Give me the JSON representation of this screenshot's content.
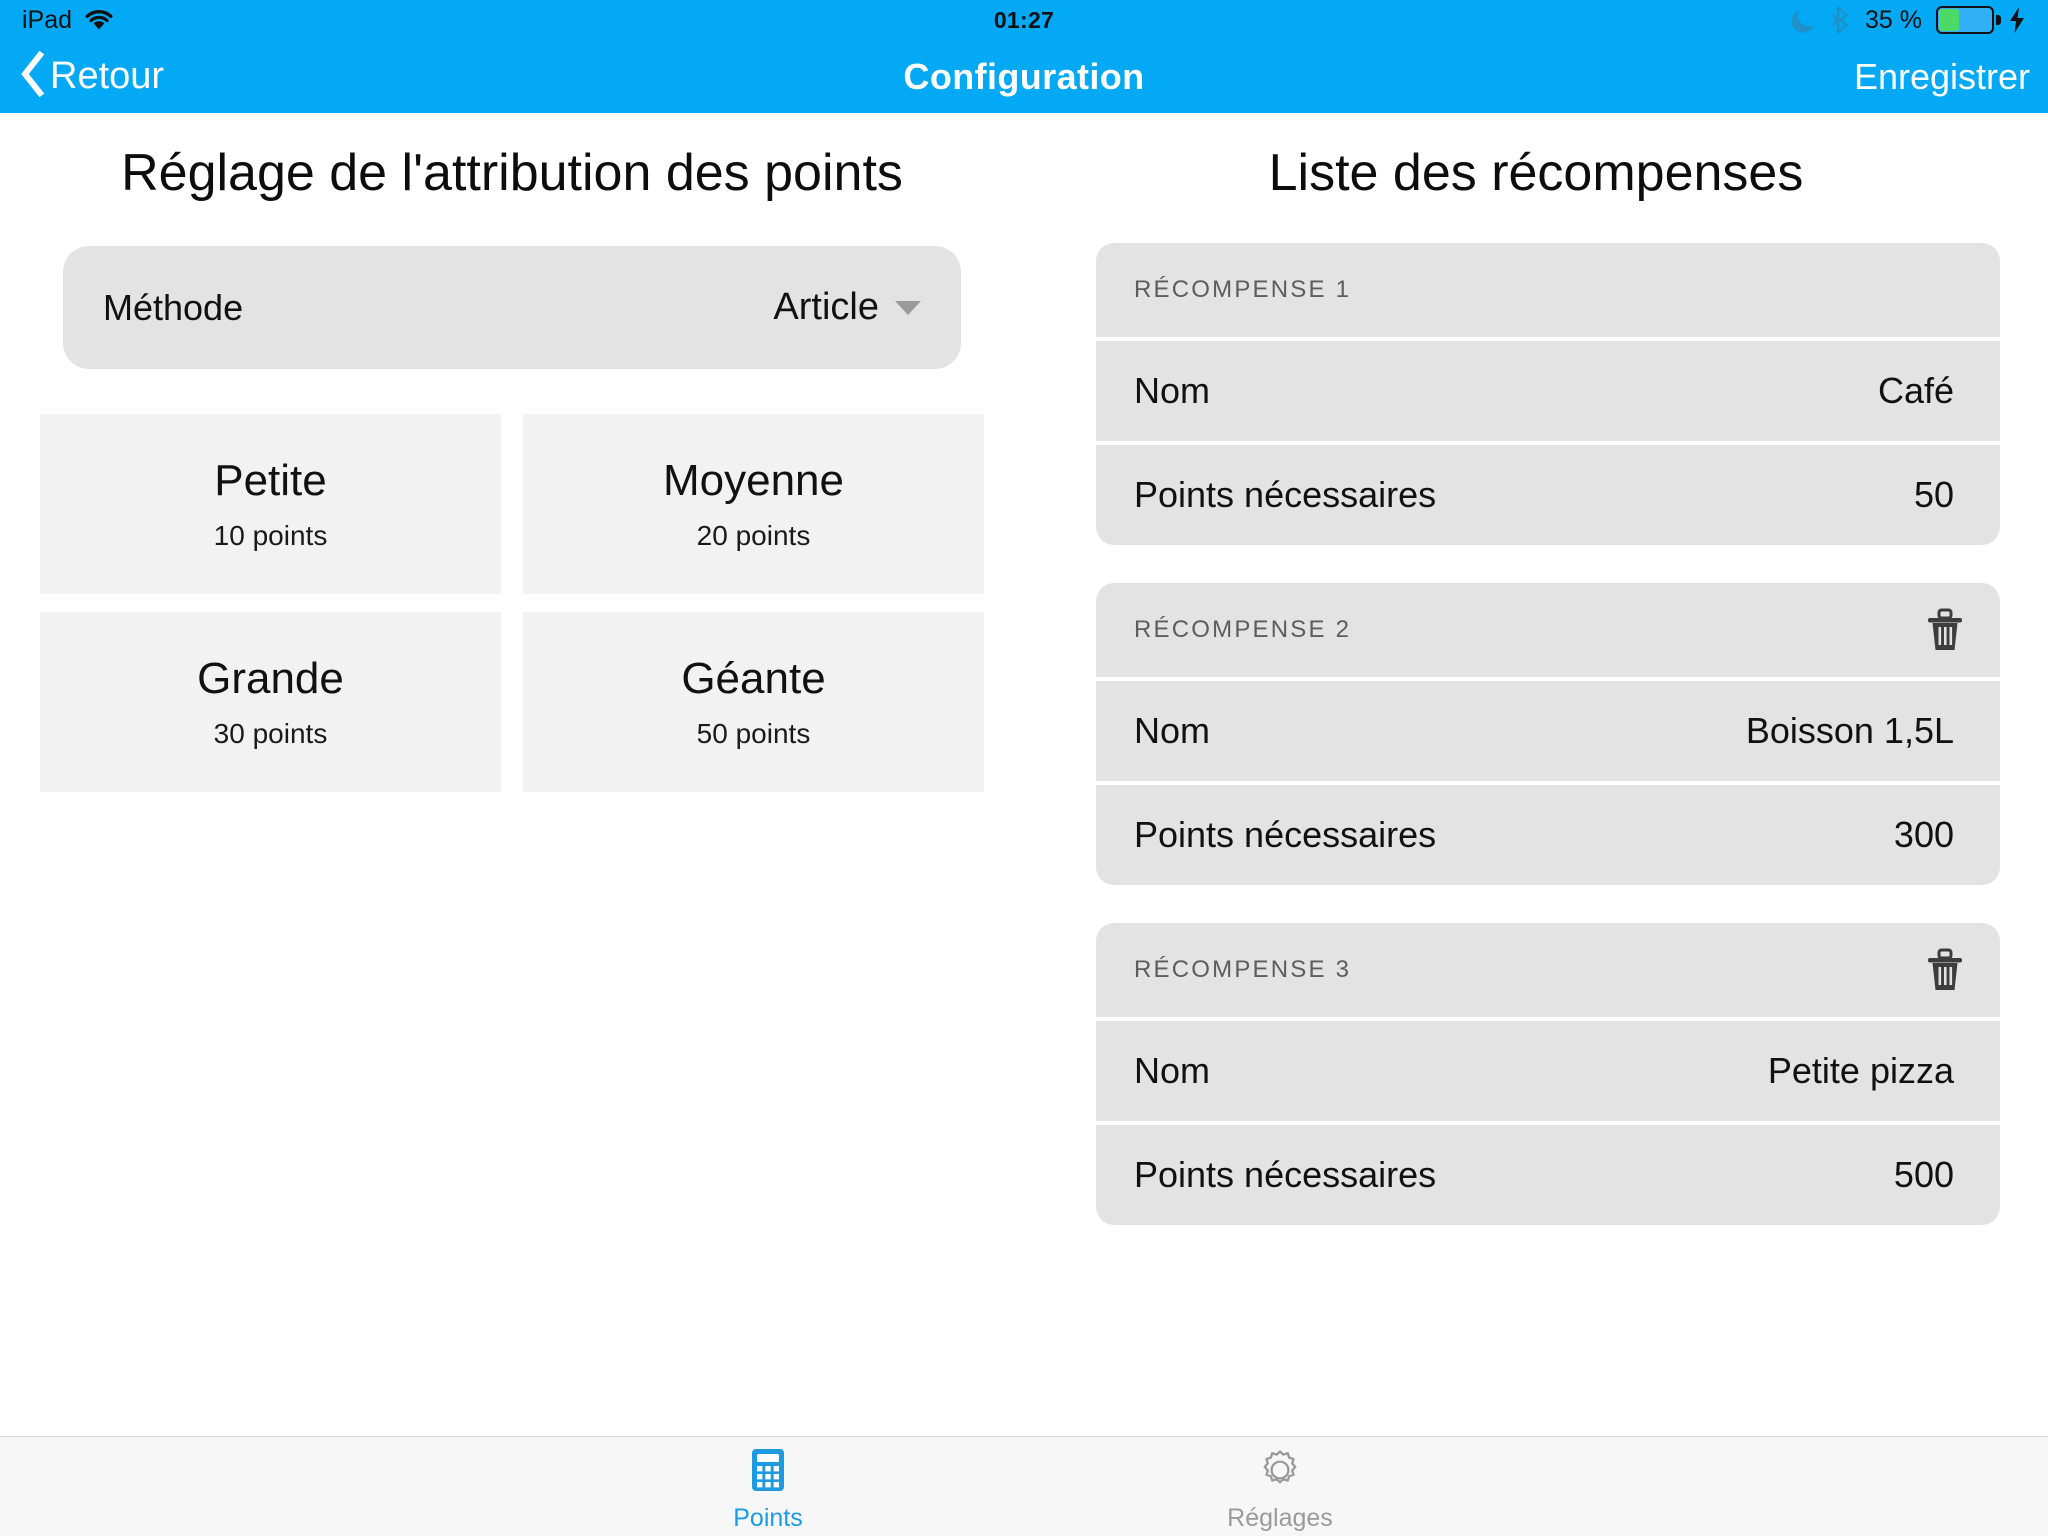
{
  "statusbar": {
    "device": "iPad",
    "wifi_icon": "wifi-icon",
    "time": "01:27",
    "dnd_icon": "moon-icon",
    "bluetooth_icon": "bluetooth-icon",
    "battery_percent": "35 %",
    "battery_icon": "battery-icon",
    "charging_icon": "lightning-bolt-icon"
  },
  "navbar": {
    "back_label": "Retour",
    "back_icon": "chevron-left-icon",
    "title": "Configuration",
    "save_label": "Enregistrer",
    "accent_color": "#03a9f4"
  },
  "left_panel": {
    "title": "Réglage de l'attribution des points",
    "method": {
      "label": "Méthode",
      "value": "Article",
      "caret_icon": "chevron-down-icon"
    },
    "sizes": [
      {
        "name": "Petite",
        "points": "10 points"
      },
      {
        "name": "Moyenne",
        "points": "20 points"
      },
      {
        "name": "Grande",
        "points": "30 points"
      },
      {
        "name": "Géante",
        "points": "50 points"
      }
    ]
  },
  "right_panel": {
    "title": "Liste des récompenses",
    "row_labels": {
      "name": "Nom",
      "points": "Points nécessaires"
    },
    "rewards": [
      {
        "header": "RÉCOMPENSE 1",
        "deletable": false,
        "name_label": "Nom",
        "name_value": "Café",
        "points_label": "Points nécessaires",
        "points_value": "50"
      },
      {
        "header": "RÉCOMPENSE 2",
        "deletable": true,
        "delete_icon": "trash-icon",
        "name_label": "Nom",
        "name_value": "Boisson 1,5L",
        "points_label": "Points nécessaires",
        "points_value": "300"
      },
      {
        "header": "RÉCOMPENSE 3",
        "deletable": true,
        "delete_icon": "trash-icon",
        "name_label": "Nom",
        "name_value": "Petite pizza",
        "points_label": "Points nécessaires",
        "points_value": "500"
      }
    ]
  },
  "tabbar": {
    "tabs": [
      {
        "label": "Points",
        "icon": "calculator-icon",
        "active": true,
        "color": "#1e9ae0"
      },
      {
        "label": "Réglages",
        "icon": "gear-icon",
        "active": false,
        "color": "#9a9a9a"
      }
    ]
  }
}
